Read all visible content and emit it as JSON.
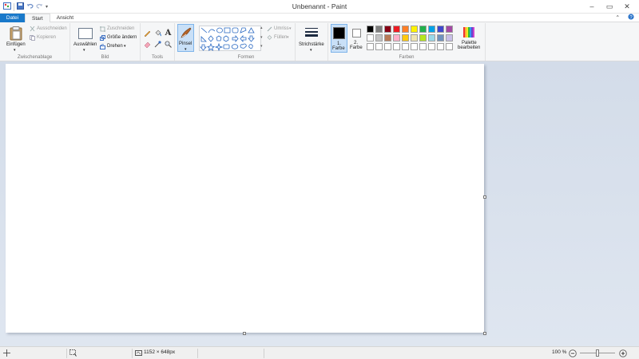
{
  "window": {
    "title": "Unbenannt - Paint"
  },
  "tabs": [
    {
      "label": "Datei"
    },
    {
      "label": "Start"
    },
    {
      "label": "Ansicht"
    }
  ],
  "clipboard": {
    "paste_label": "Einfügen",
    "cut_label": "Ausschneiden",
    "copy_label": "Kopieren",
    "group_label": "Zwischenablage"
  },
  "image": {
    "select_label": "Auswählen",
    "crop_label": "Zuschneiden",
    "resize_label": "Größe ändern",
    "rotate_label": "Drehen",
    "group_label": "Bild"
  },
  "tools": {
    "group_label": "Tools"
  },
  "brushes": {
    "label": "Pinsel"
  },
  "shapes": {
    "outline_label": "Umriss",
    "fill_label": "Füllen",
    "group_label": "Formen"
  },
  "size": {
    "label": "Strichstärke"
  },
  "colors": {
    "color1_label": "1.",
    "color1_sub": "Farbe",
    "color2_label": "2.",
    "color2_sub": "Farbe",
    "color1": "#000000",
    "color2": "#ffffff",
    "edit_label_1": "Palette",
    "edit_label_2": "bearbeiten",
    "group_label": "Farben",
    "palette_row1": [
      "#000000",
      "#7f7f7f",
      "#880015",
      "#ed1c24",
      "#ff7f27",
      "#fff200",
      "#22b14c",
      "#00a2e8",
      "#3f48cc",
      "#a349a4"
    ],
    "palette_row2": [
      "#ffffff",
      "#c3c3c3",
      "#b97a57",
      "#ffaec9",
      "#ffc90e",
      "#efe4b0",
      "#b5e61d",
      "#99d9ea",
      "#7092be",
      "#c8bfe7"
    ],
    "palette_row3": [
      "#ffffff",
      "#ffffff",
      "#ffffff",
      "#ffffff",
      "#ffffff",
      "#ffffff",
      "#ffffff",
      "#ffffff",
      "#ffffff",
      "#ffffff"
    ]
  },
  "status": {
    "image_size": "1152 × 648px",
    "zoom": "100 %",
    "zoom_fraction": 0.5
  }
}
